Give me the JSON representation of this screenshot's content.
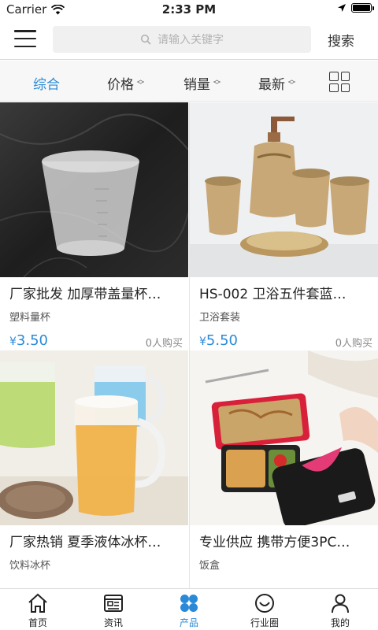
{
  "status": {
    "carrier": "Carrier",
    "time": "2:33 PM"
  },
  "header": {
    "search_placeholder": "请输入关键字",
    "search_button": "搜索"
  },
  "sort": {
    "items": [
      {
        "label": "综合"
      },
      {
        "label": "价格"
      },
      {
        "label": "销量"
      },
      {
        "label": "最新"
      }
    ]
  },
  "products": [
    {
      "title": "厂家批发 加厚带盖量杯…",
      "category": "塑料量杯",
      "currency": "¥",
      "price": "3.50",
      "sold": "0人购买"
    },
    {
      "title": "HS-002 卫浴五件套蓝…",
      "category": "卫浴套装",
      "currency": "¥",
      "price": "5.50",
      "sold": "0人购买"
    },
    {
      "title": "厂家热销 夏季液体冰杯…",
      "category": "饮料冰杯",
      "currency": "",
      "price": "",
      "sold": ""
    },
    {
      "title": "专业供应 携带方便3PC…",
      "category": "饭盒",
      "currency": "",
      "price": "",
      "sold": ""
    }
  ],
  "tabs": [
    {
      "label": "首页",
      "icon": "home-icon"
    },
    {
      "label": "资讯",
      "icon": "news-icon"
    },
    {
      "label": "产品",
      "icon": "products-icon"
    },
    {
      "label": "行业圈",
      "icon": "industry-circle-icon"
    },
    {
      "label": "我的",
      "icon": "profile-icon"
    }
  ],
  "colors": {
    "accent": "#2b8ad8"
  }
}
